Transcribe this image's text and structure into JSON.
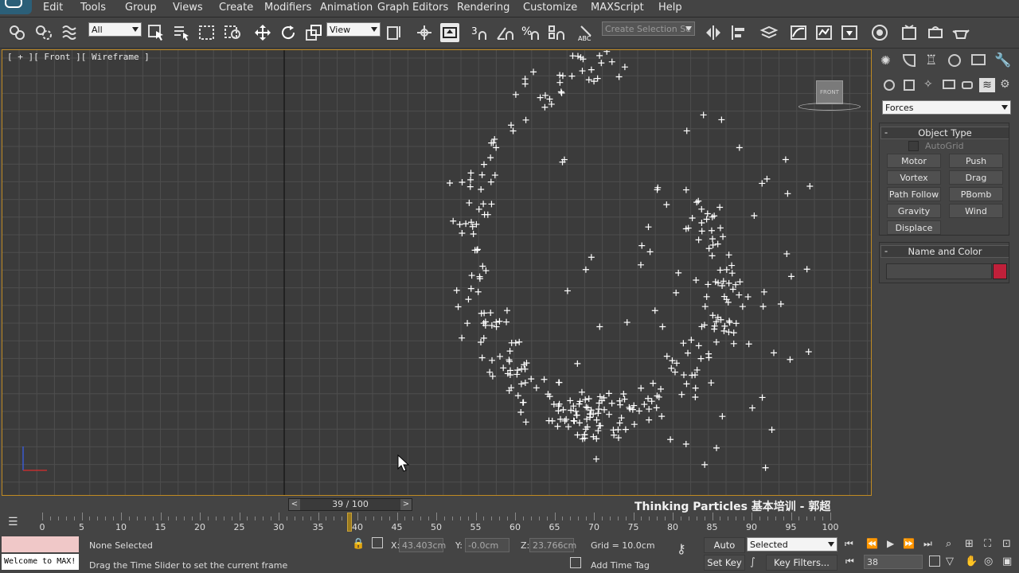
{
  "menu": [
    "Edit",
    "Tools",
    "Group",
    "Views",
    "Create",
    "Modifiers",
    "Animation",
    "Graph Editors",
    "Rendering",
    "Customize",
    "MAXScript",
    "Help"
  ],
  "toolbar": {
    "filter_value": "All",
    "refcoord_value": "View",
    "selection_set_placeholder": "Create Selection Se"
  },
  "viewport": {
    "label": "[ + ][ Front ][ Wireframe ]",
    "viewcube_label": "FRONT",
    "watermark": "Thinking Particles 基本培训 - 郭超"
  },
  "command_panel": {
    "category": "Forces",
    "object_type_title": "Object Type",
    "autogrid_label": "AutoGrid",
    "buttons": [
      "Motor",
      "Push",
      "Vortex",
      "Drag",
      "Path Follow",
      "PBomb",
      "Gravity",
      "Wind",
      "Displace"
    ],
    "name_color_title": "Name and Color",
    "color_swatch": "#c0203a"
  },
  "timeline": {
    "slider_text": "39 / 100",
    "prev": "<",
    "next": ">",
    "current_frame": 39,
    "ticks": [
      0,
      5,
      10,
      15,
      20,
      25,
      30,
      35,
      40,
      45,
      50,
      55,
      60,
      65,
      70,
      75,
      80,
      85,
      90,
      95,
      100
    ]
  },
  "status": {
    "listener": "Welcome to MAX!",
    "selection": "None Selected",
    "prompt": "Drag the Time Slider to set the current frame",
    "x_label": "X:",
    "x_value": "43.403cm",
    "y_label": "Y:",
    "y_value": "-0.0cm",
    "z_label": "Z:",
    "z_value": "23.766cm",
    "grid": "Grid = 10.0cm",
    "add_time_tag": "Add Time Tag",
    "auto_key": "Auto Key",
    "set_key": "Set Key",
    "key_mode": "Selected",
    "key_filters": "Key Filters...",
    "frame_field": "38"
  },
  "colors": {
    "viewport_border": "#c08a22",
    "accent_red": "#c0203a",
    "listener_bg": "#f0c8c8"
  }
}
